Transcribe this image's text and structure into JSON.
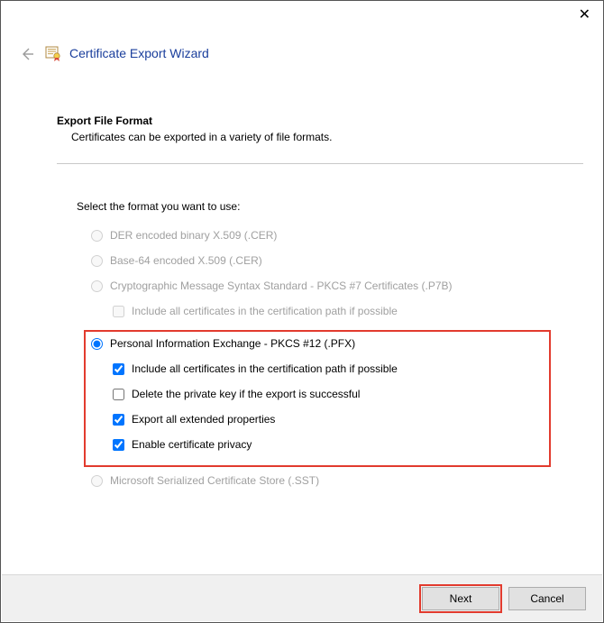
{
  "window": {
    "title": "Certificate Export Wizard"
  },
  "section": {
    "title": "Export File Format",
    "description": "Certificates can be exported in a variety of file formats."
  },
  "prompt": "Select the format you want to use:",
  "options": {
    "der": "DER encoded binary X.509 (.CER)",
    "base64": "Base-64 encoded X.509 (.CER)",
    "pkcs7": "Cryptographic Message Syntax Standard - PKCS #7 Certificates (.P7B)",
    "pkcs7_include": "Include all certificates in the certification path if possible",
    "pfx": "Personal Information Exchange - PKCS #12 (.PFX)",
    "pfx_include_path": "Include all certificates in the certification path if possible",
    "pfx_delete_key": "Delete the private key if the export is successful",
    "pfx_export_ext": "Export all extended properties",
    "pfx_privacy": "Enable certificate privacy",
    "sst": "Microsoft Serialized Certificate Store (.SST)"
  },
  "buttons": {
    "next": "Next",
    "cancel": "Cancel"
  }
}
